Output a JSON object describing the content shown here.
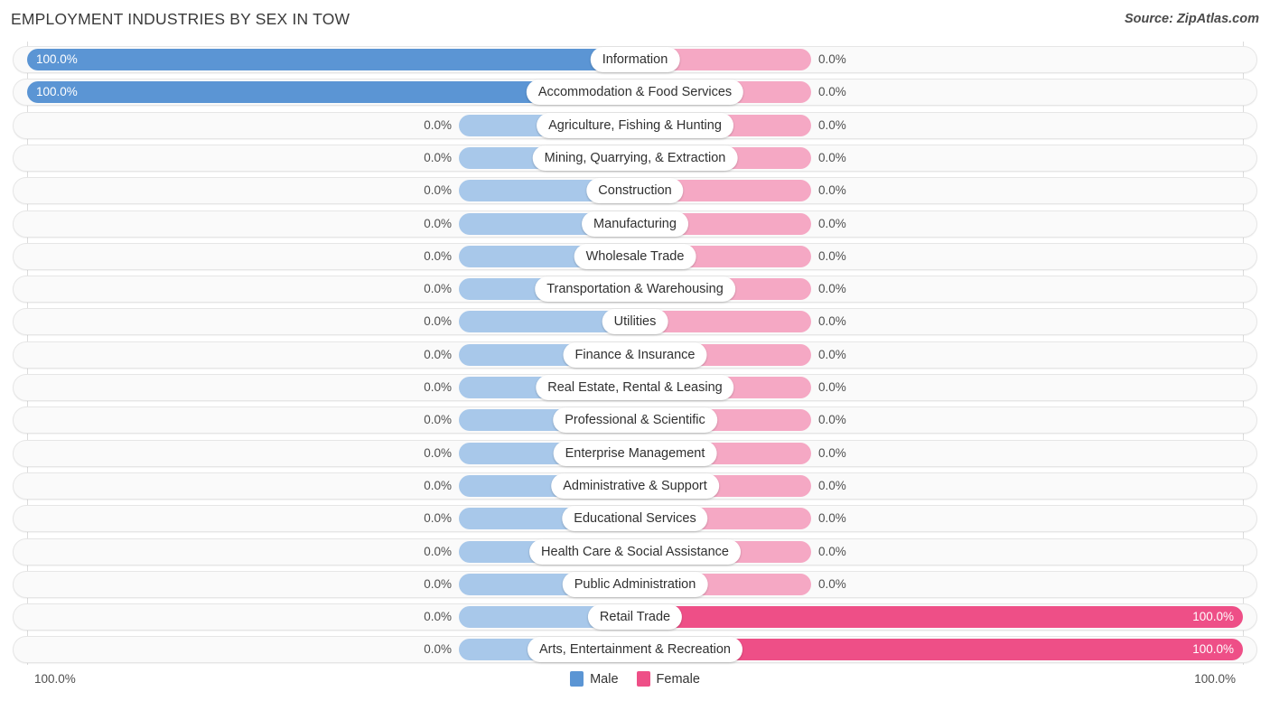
{
  "header": {
    "title": "EMPLOYMENT INDUSTRIES BY SEX IN TOW",
    "source": "Source: ZipAtlas.com"
  },
  "legend": {
    "male": {
      "label": "Male",
      "color": "#5b95d4"
    },
    "female": {
      "label": "Female",
      "color": "#ee4f87"
    }
  },
  "axis": {
    "left_label": "100.0%",
    "right_label": "100.0%"
  },
  "colors": {
    "male_full": "#5b95d4",
    "male_zero": "#a8c8ea",
    "female_full": "#ee4f87",
    "female_zero": "#f5a8c4",
    "track": "#fafafa",
    "track_border": "#e6e6e6",
    "gridline": "#dcdcdc"
  },
  "chart_data": {
    "type": "bar",
    "title": "EMPLOYMENT INDUSTRIES BY SEX IN TOW",
    "subtitle": "",
    "xlabel": "",
    "ylabel": "",
    "orientation": "horizontal-diverging",
    "xlim": [
      0,
      100
    ],
    "grid": true,
    "legend_position": "bottom-center",
    "categories": [
      "Information",
      "Accommodation & Food Services",
      "Agriculture, Fishing & Hunting",
      "Mining, Quarrying, & Extraction",
      "Construction",
      "Manufacturing",
      "Wholesale Trade",
      "Transportation & Warehousing",
      "Utilities",
      "Finance & Insurance",
      "Real Estate, Rental & Leasing",
      "Professional & Scientific",
      "Enterprise Management",
      "Administrative & Support",
      "Educational Services",
      "Health Care & Social Assistance",
      "Public Administration",
      "Retail Trade",
      "Arts, Entertainment & Recreation"
    ],
    "series": [
      {
        "name": "Male",
        "values": [
          100.0,
          100.0,
          0.0,
          0.0,
          0.0,
          0.0,
          0.0,
          0.0,
          0.0,
          0.0,
          0.0,
          0.0,
          0.0,
          0.0,
          0.0,
          0.0,
          0.0,
          0.0,
          0.0
        ],
        "labels": [
          "100.0%",
          "100.0%",
          "0.0%",
          "0.0%",
          "0.0%",
          "0.0%",
          "0.0%",
          "0.0%",
          "0.0%",
          "0.0%",
          "0.0%",
          "0.0%",
          "0.0%",
          "0.0%",
          "0.0%",
          "0.0%",
          "0.0%",
          "0.0%",
          "0.0%"
        ]
      },
      {
        "name": "Female",
        "values": [
          0.0,
          0.0,
          0.0,
          0.0,
          0.0,
          0.0,
          0.0,
          0.0,
          0.0,
          0.0,
          0.0,
          0.0,
          0.0,
          0.0,
          0.0,
          0.0,
          0.0,
          100.0,
          100.0
        ],
        "labels": [
          "0.0%",
          "0.0%",
          "0.0%",
          "0.0%",
          "0.0%",
          "0.0%",
          "0.0%",
          "0.0%",
          "0.0%",
          "0.0%",
          "0.0%",
          "0.0%",
          "0.0%",
          "0.0%",
          "0.0%",
          "0.0%",
          "0.0%",
          "100.0%",
          "100.0%"
        ]
      }
    ]
  }
}
